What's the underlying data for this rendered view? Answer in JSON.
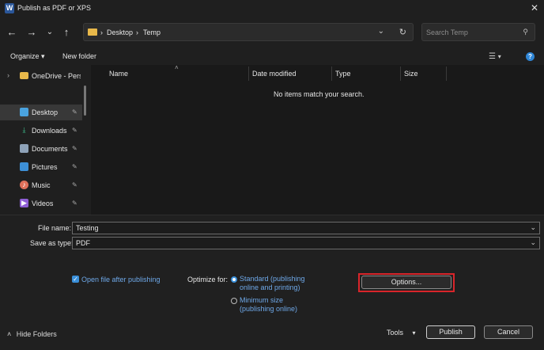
{
  "window": {
    "title": "Publish as PDF or XPS",
    "app_icon_letter": "W"
  },
  "address": {
    "segments": [
      "Desktop",
      "Temp"
    ]
  },
  "search": {
    "placeholder": "Search Temp"
  },
  "commands": {
    "organize": "Organize",
    "new_folder": "New folder"
  },
  "sidebar": {
    "items": [
      {
        "label": "OneDrive - Perso",
        "icon": "cloud-folder-icon"
      },
      {
        "label": "Desktop",
        "icon": "desktop-icon",
        "selected": true
      },
      {
        "label": "Downloads",
        "icon": "download-icon"
      },
      {
        "label": "Documents",
        "icon": "document-icon"
      },
      {
        "label": "Pictures",
        "icon": "pictures-icon"
      },
      {
        "label": "Music",
        "icon": "music-icon"
      },
      {
        "label": "Videos",
        "icon": "video-icon"
      }
    ]
  },
  "columns": [
    "Name",
    "Date modified",
    "Type",
    "Size"
  ],
  "empty_message": "No items match your search.",
  "form": {
    "file_name_label": "File name:",
    "file_name_value": "Testing",
    "save_type_label": "Save as type:",
    "save_type_value": "PDF",
    "open_after_label": "Open file after publishing",
    "optimize_label": "Optimize for:",
    "standard_line1": "Standard (publishing",
    "standard_line2": "online and printing)",
    "minimum_line1": "Minimum size",
    "minimum_line2": "(publishing online)",
    "options_button": "Options..."
  },
  "footer": {
    "hide_folders": "Hide Folders",
    "tools": "Tools",
    "publish": "Publish",
    "cancel": "Cancel"
  },
  "colors": {
    "accent": "#3a8fd9",
    "highlight_box": "#d9252a"
  }
}
